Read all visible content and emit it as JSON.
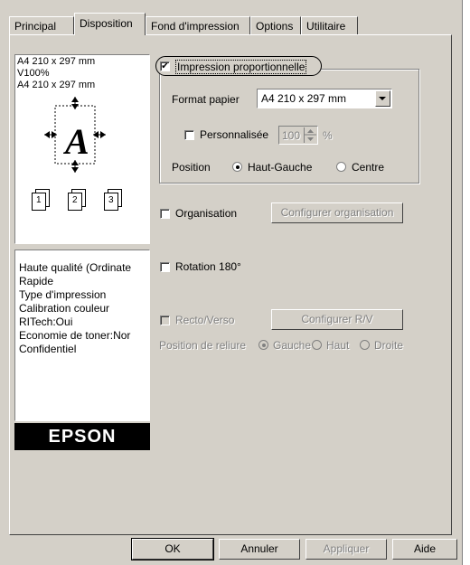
{
  "tabs": [
    {
      "label": "Principal"
    },
    {
      "label": "Disposition"
    },
    {
      "label": "Fond d'impression"
    },
    {
      "label": "Options"
    },
    {
      "label": "Utilitaire"
    }
  ],
  "preview": {
    "line1": "A4 210 x 297 mm",
    "line2": "V100%",
    "line3": "A4 210 x 297 mm",
    "glyph": "A",
    "pages": [
      "1",
      "2",
      "3"
    ]
  },
  "summary": {
    "items": [
      "Haute qualité (Ordinate",
      "Rapide",
      "Type d'impression",
      "Calibration couleur",
      "RITech:Oui",
      "Economie de toner:Nor",
      "Confidentiel"
    ]
  },
  "brand": "EPSON",
  "proportional": {
    "label": "Impression proportionnelle",
    "checked": true
  },
  "paper_format": {
    "label": "Format papier",
    "value": "A4 210 x 297 mm"
  },
  "custom": {
    "label": "Personnalisée",
    "value": "100",
    "unit": "%"
  },
  "position": {
    "label": "Position",
    "top_left": "Haut-Gauche",
    "center": "Centre",
    "selected": "top_left"
  },
  "organisation": {
    "label": "Organisation",
    "button": "Configurer organisation"
  },
  "rotation": {
    "label": "Rotation 180°"
  },
  "duplex": {
    "label": "Recto/Verso",
    "button": "Configurer R/V"
  },
  "binding": {
    "label": "Position de reliure",
    "left": "Gauche",
    "top": "Haut",
    "right": "Droite"
  },
  "footer": {
    "ok": "OK",
    "cancel": "Annuler",
    "apply": "Appliquer",
    "help": "Aide"
  }
}
